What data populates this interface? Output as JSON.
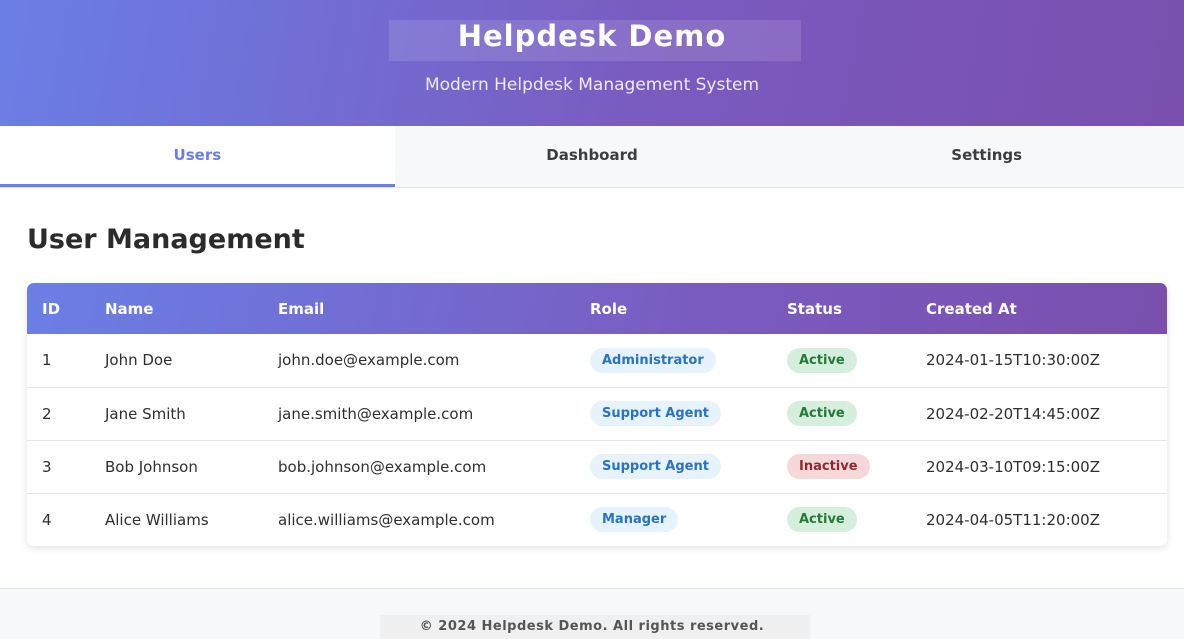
{
  "header": {
    "title": "Helpdesk Demo",
    "subtitle": "Modern Helpdesk Management System"
  },
  "tabs": [
    {
      "label": "Users",
      "active": true
    },
    {
      "label": "Dashboard",
      "active": false
    },
    {
      "label": "Settings",
      "active": false
    }
  ],
  "main": {
    "title": "User Management",
    "table": {
      "columns": [
        "ID",
        "Name",
        "Email",
        "Role",
        "Status",
        "Created At"
      ],
      "rows": [
        {
          "id": "1",
          "name": "John Doe",
          "email": "john.doe@example.com",
          "role": "Administrator",
          "status": "Active",
          "created_at": "2024-01-15T10:30:00Z"
        },
        {
          "id": "2",
          "name": "Jane Smith",
          "email": "jane.smith@example.com",
          "role": "Support Agent",
          "status": "Active",
          "created_at": "2024-02-20T14:45:00Z"
        },
        {
          "id": "3",
          "name": "Bob Johnson",
          "email": "bob.johnson@example.com",
          "role": "Support Agent",
          "status": "Inactive",
          "created_at": "2024-03-10T09:15:00Z"
        },
        {
          "id": "4",
          "name": "Alice Williams",
          "email": "alice.williams@example.com",
          "role": "Manager",
          "status": "Active",
          "created_at": "2024-04-05T11:20:00Z"
        }
      ]
    }
  },
  "footer": {
    "text": "© 2024 Helpdesk Demo. All rights reserved."
  },
  "colors": {
    "accent": "#6a7fe6",
    "gradient_end": "#7a4fae",
    "active_bg": "#d5efdc",
    "inactive_bg": "#f7d8da",
    "role_bg": "#e6f2fc"
  }
}
